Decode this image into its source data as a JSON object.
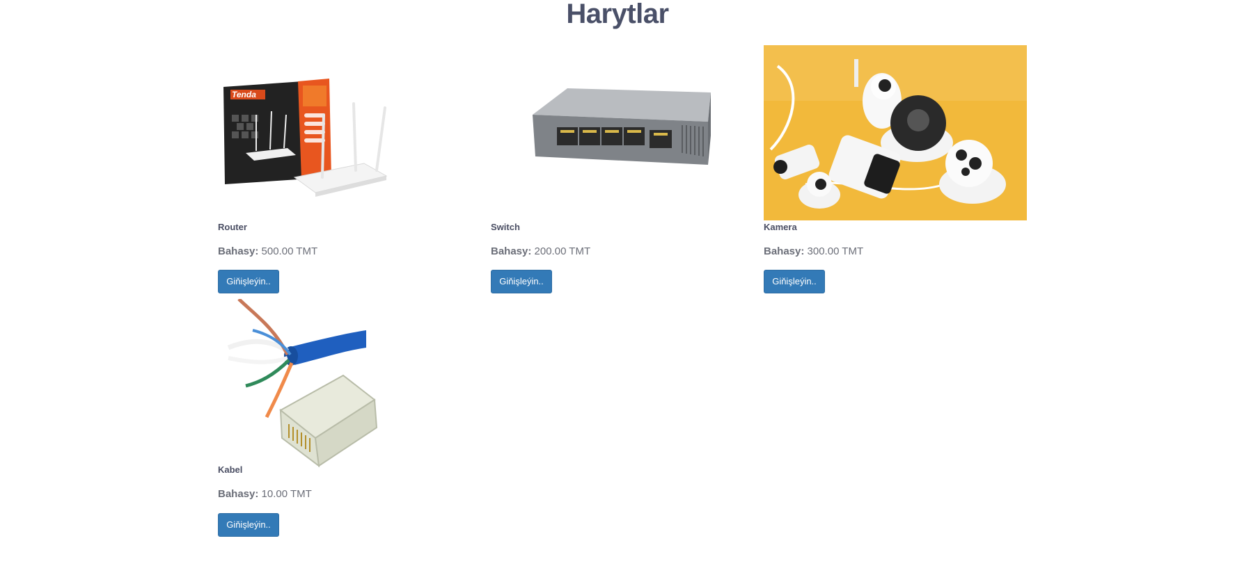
{
  "page": {
    "title": "Harytlar"
  },
  "products": [
    {
      "name": "Router",
      "price_label": "Bahasy:",
      "price": "500.00 TMT",
      "button_label": "Giňişleýin..",
      "image_icon": "router-image"
    },
    {
      "name": "Switch",
      "price_label": "Bahasy:",
      "price": "200.00 TMT",
      "button_label": "Giňişleýin..",
      "image_icon": "switch-image"
    },
    {
      "name": "Kamera",
      "price_label": "Bahasy:",
      "price": "300.00 TMT",
      "button_label": "Giňişleýin..",
      "image_icon": "camera-image"
    },
    {
      "name": "Kabel",
      "price_label": "Bahasy:",
      "price": "10.00 TMT",
      "button_label": "Giňişleýin..",
      "image_icon": "cable-image"
    }
  ],
  "colors": {
    "button_bg": "#337ab7",
    "title": "#4a5068",
    "camera_bg": "#f2b93b",
    "cable_blue": "#1f5fbf"
  },
  "images": {
    "router_box_text_brand": "Tenda",
    "router_box_text_tag": "Wireless N300 Easy Setup Router"
  }
}
